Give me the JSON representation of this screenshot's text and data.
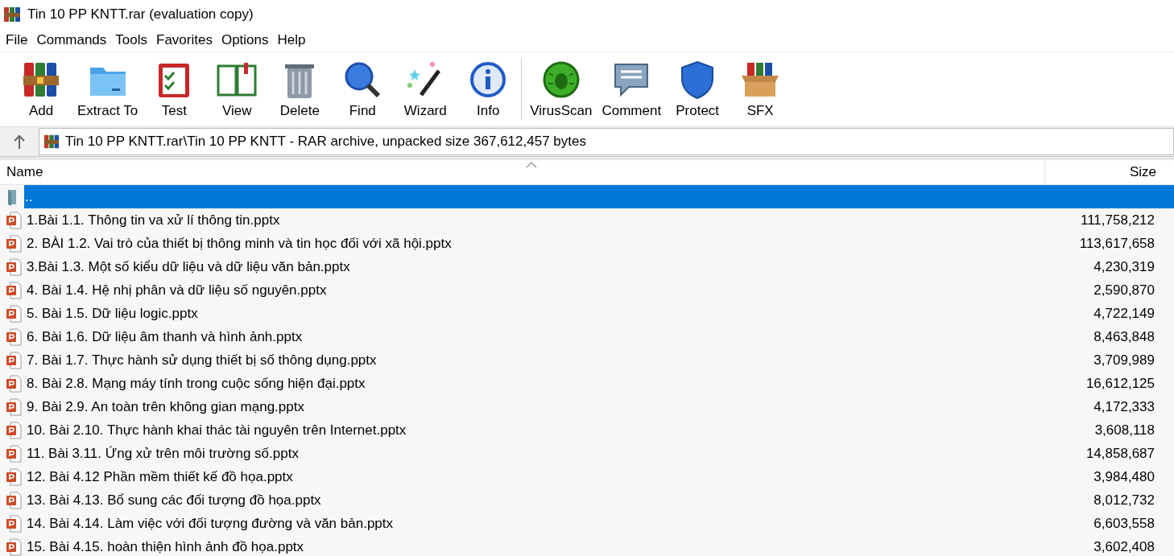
{
  "window": {
    "title": "Tin 10 PP KNTT.rar (evaluation copy)"
  },
  "menu": [
    "File",
    "Commands",
    "Tools",
    "Favorites",
    "Options",
    "Help"
  ],
  "toolbar": [
    {
      "label": "Add"
    },
    {
      "label": "Extract To"
    },
    {
      "label": "Test"
    },
    {
      "label": "View"
    },
    {
      "label": "Delete"
    },
    {
      "label": "Find"
    },
    {
      "label": "Wizard"
    },
    {
      "label": "Info"
    },
    {
      "label": "VirusScan"
    },
    {
      "label": "Comment"
    },
    {
      "label": "Protect"
    },
    {
      "label": "SFX"
    }
  ],
  "address": {
    "path": "Tin 10 PP KNTT.rar\\Tin 10 PP KNTT - RAR archive, unpacked size 367,612,457 bytes"
  },
  "table": {
    "columns": [
      "Name",
      "Size"
    ],
    "rows": [
      {
        "kind": "folder",
        "name": "..",
        "size": "",
        "selected": true
      },
      {
        "kind": "file",
        "name": "1.Bài 1.1. Thông tin va xử lí thông tin.pptx",
        "size": "111,758,212",
        "selected": false
      },
      {
        "kind": "file",
        "name": "2. BÀI 1.2. Vai trò của thiết bị thông minh và tin học đối với xã hội.pptx",
        "size": "113,617,658",
        "selected": false
      },
      {
        "kind": "file",
        "name": "3.Bài 1.3. Một số kiểu dữ liệu và dữ liệu văn bản.pptx",
        "size": "4,230,319",
        "selected": false
      },
      {
        "kind": "file",
        "name": "4. Bài 1.4. Hệ nhị phân và dữ liệu số nguyên.pptx",
        "size": "2,590,870",
        "selected": false
      },
      {
        "kind": "file",
        "name": "5. Bài 1.5. Dữ liệu logic.pptx",
        "size": "4,722,149",
        "selected": false
      },
      {
        "kind": "file",
        "name": "6. Bài 1.6. Dữ liệu âm thanh và hình ảnh.pptx",
        "size": "8,463,848",
        "selected": false
      },
      {
        "kind": "file",
        "name": "7. Bài 1.7. Thực hành sử dụng thiết bị số thông dụng.pptx",
        "size": "3,709,989",
        "selected": false
      },
      {
        "kind": "file",
        "name": "8. Bài 2.8. Mạng máy tính trong cuộc sống hiện đại.pptx",
        "size": "16,612,125",
        "selected": false
      },
      {
        "kind": "file",
        "name": "9. Bài 2.9. An toàn trên không gian mạng.pptx",
        "size": "4,172,333",
        "selected": false
      },
      {
        "kind": "file",
        "name": "10. Bài 2.10. Thực hành khai thác tài nguyên trên Internet.pptx",
        "size": "3,608,118",
        "selected": false
      },
      {
        "kind": "file",
        "name": "11. Bài 3.11. Ứng xử trên môi trường số.pptx",
        "size": "14,858,687",
        "selected": false
      },
      {
        "kind": "file",
        "name": "12. Bài 4.12 Phần mềm thiết kế đồ họa.pptx",
        "size": "3,984,480",
        "selected": false
      },
      {
        "kind": "file",
        "name": "13. Bài 4.13. Bổ sung các đối tượng đồ họa.pptx",
        "size": "8,012,732",
        "selected": false
      },
      {
        "kind": "file",
        "name": "14. Bài 4.14. Làm việc với đối tượng đường và văn bản.pptx",
        "size": "6,603,558",
        "selected": false
      },
      {
        "kind": "file",
        "name": "15. Bài 4.15. hoàn thiện hình ảnh đồ họa.pptx",
        "size": "3,602,408",
        "selected": false
      }
    ]
  }
}
